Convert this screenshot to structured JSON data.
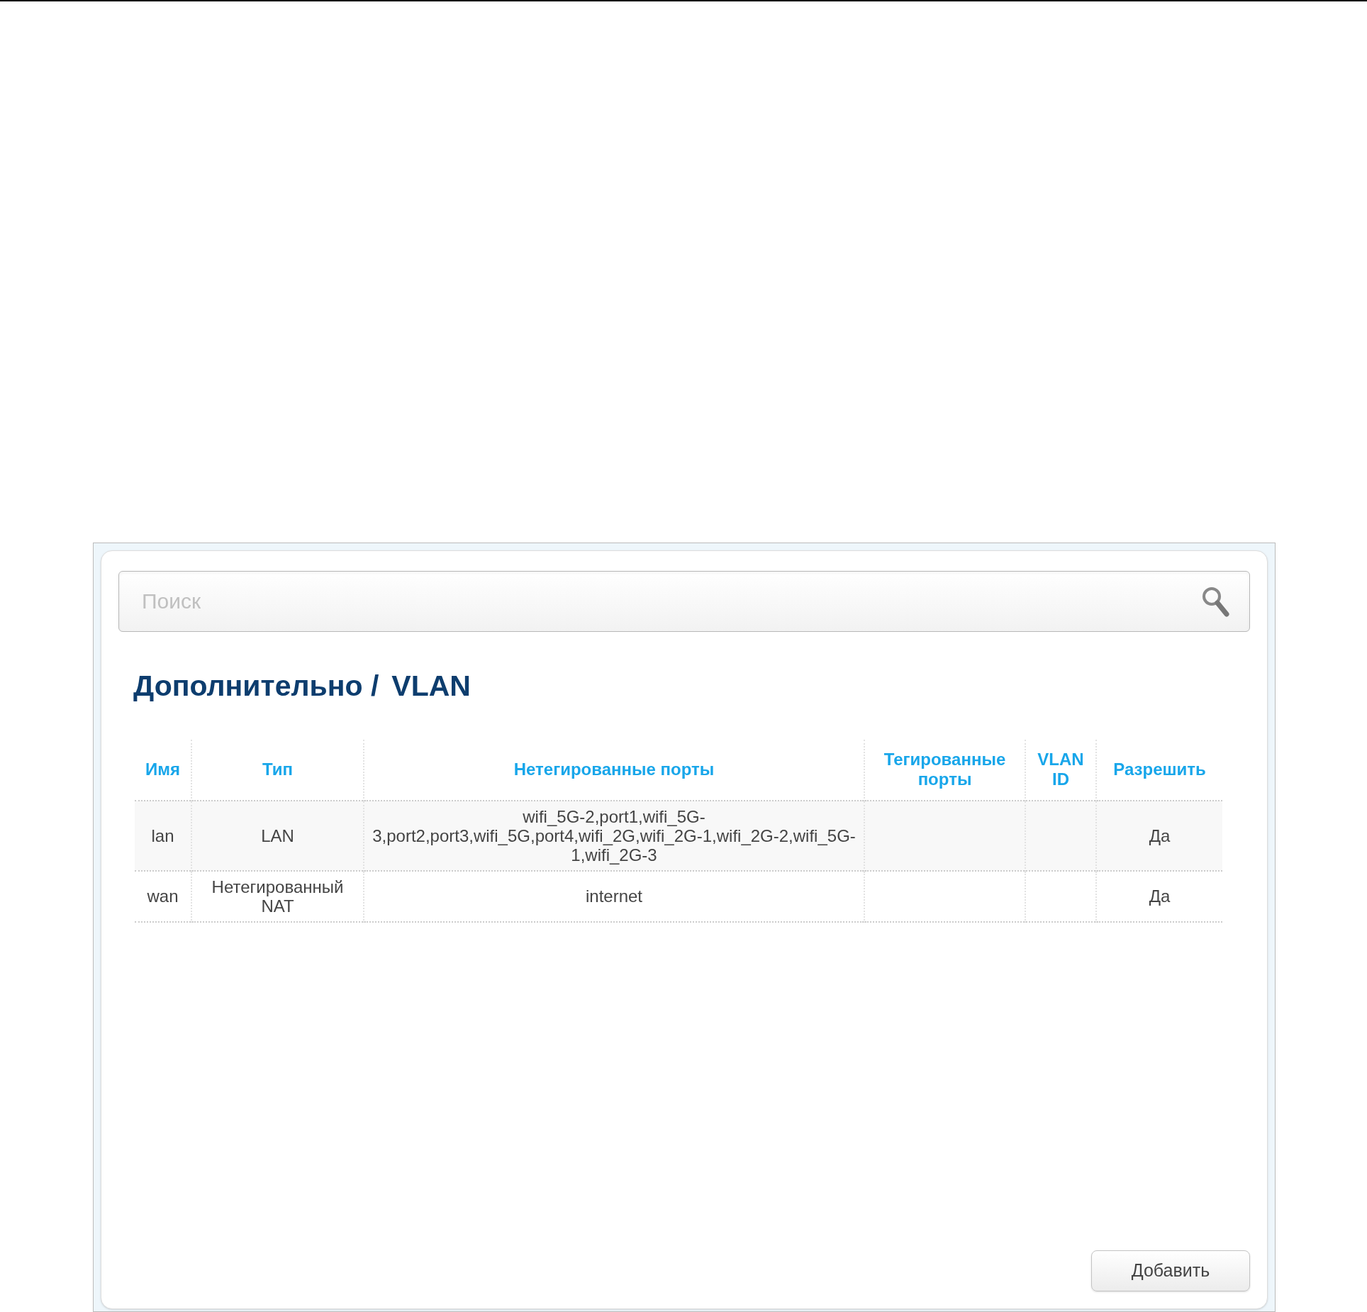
{
  "search": {
    "placeholder": "Поиск"
  },
  "title": {
    "section": "Дополнительно /",
    "page": "VLAN"
  },
  "table": {
    "columns": [
      "Имя",
      "Тип",
      "Нетегированные порты",
      "Тегированные порты",
      "VLAN ID",
      "Разрешить"
    ],
    "rows": [
      {
        "cells": [
          "lan",
          "LAN",
          "wifi_5G-2,port1,wifi_5G-3,port2,port3,wifi_5G,port4,wifi_2G,wifi_2G-1,wifi_2G-2,wifi_5G-1,wifi_2G-3",
          "",
          "",
          "Да"
        ]
      },
      {
        "cells": [
          "wan",
          "Нетегированный NAT",
          "internet",
          "",
          "",
          "Да"
        ]
      }
    ]
  },
  "buttons": [
    "Добавить"
  ]
}
